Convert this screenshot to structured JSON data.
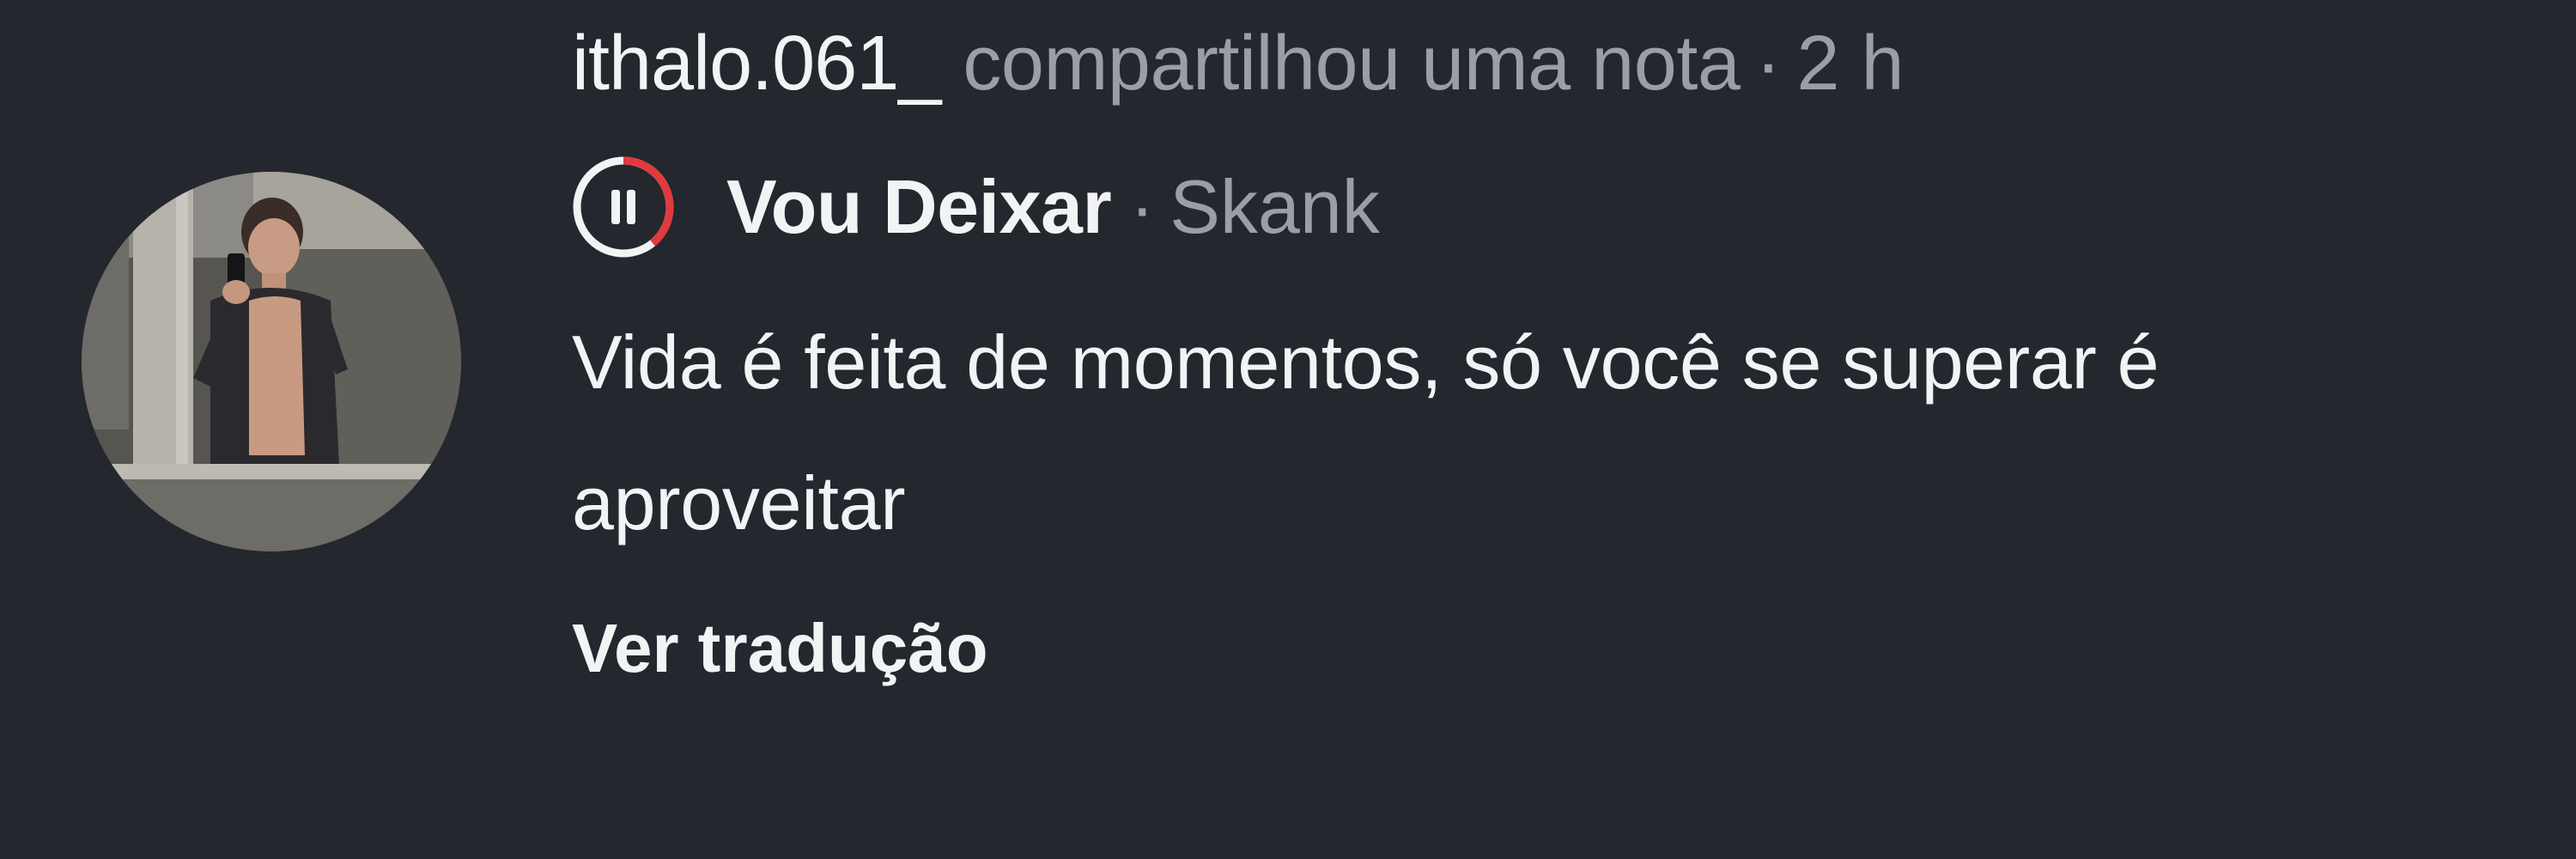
{
  "note": {
    "username": "ithalo.061_",
    "action_text": "compartilhou uma nota",
    "separator": "·",
    "time_ago": "2 h",
    "music": {
      "play_state_icon": "pause-icon",
      "song_title": "Vou Deixar",
      "separator": "·",
      "artist": "Skank",
      "progress_color": "#e03a3e"
    },
    "text": "Vida é feita de momentos, só você se superar é aproveitar",
    "translate_label": "Ver tradução"
  },
  "colors": {
    "background": "#24272d",
    "primary_text": "#f2f3f5",
    "secondary_text": "#9a9ea6",
    "accent": "#e03a3e"
  }
}
